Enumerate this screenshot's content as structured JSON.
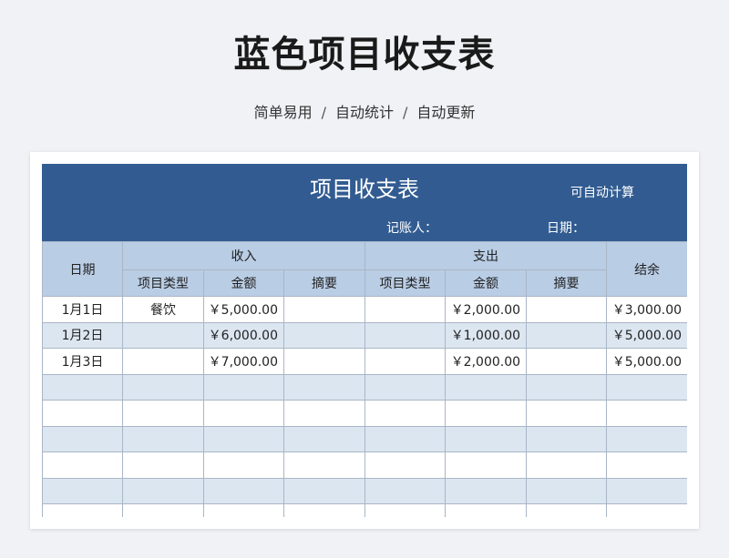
{
  "page": {
    "title": "蓝色项目收支表",
    "subtitle": [
      "简单易用",
      "自动统计",
      "自动更新"
    ],
    "subtitle_separator": "/"
  },
  "sheet": {
    "title": "项目收支表",
    "auto_calc": "可自动计算",
    "recorder_label": "记账人：",
    "date_label": "日期："
  },
  "table": {
    "headers": {
      "date": "日期",
      "income": "收入",
      "expense": "支出",
      "balance": "结余",
      "type": "项目类型",
      "amount": "金额",
      "memo": "摘要"
    },
    "rows": [
      {
        "date": "1月1日",
        "in_type": "餐饮",
        "in_amount": "￥5,000.00",
        "in_memo": "",
        "out_type": "",
        "out_amount": "￥2,000.00",
        "out_memo": "",
        "balance": "￥3,000.00"
      },
      {
        "date": "1月2日",
        "in_type": "",
        "in_amount": "￥6,000.00",
        "in_memo": "",
        "out_type": "",
        "out_amount": "￥1,000.00",
        "out_memo": "",
        "balance": "￥5,000.00"
      },
      {
        "date": "1月3日",
        "in_type": "",
        "in_amount": "￥7,000.00",
        "in_memo": "",
        "out_type": "",
        "out_amount": "￥2,000.00",
        "out_memo": "",
        "balance": "￥5,000.00"
      },
      {
        "date": "",
        "in_type": "",
        "in_amount": "",
        "in_memo": "",
        "out_type": "",
        "out_amount": "",
        "out_memo": "",
        "balance": ""
      },
      {
        "date": "",
        "in_type": "",
        "in_amount": "",
        "in_memo": "",
        "out_type": "",
        "out_amount": "",
        "out_memo": "",
        "balance": ""
      },
      {
        "date": "",
        "in_type": "",
        "in_amount": "",
        "in_memo": "",
        "out_type": "",
        "out_amount": "",
        "out_memo": "",
        "balance": ""
      },
      {
        "date": "",
        "in_type": "",
        "in_amount": "",
        "in_memo": "",
        "out_type": "",
        "out_amount": "",
        "out_memo": "",
        "balance": ""
      },
      {
        "date": "",
        "in_type": "",
        "in_amount": "",
        "in_memo": "",
        "out_type": "",
        "out_amount": "",
        "out_memo": "",
        "balance": ""
      },
      {
        "date": "",
        "in_type": "",
        "in_amount": "",
        "in_memo": "",
        "out_type": "",
        "out_amount": "",
        "out_memo": "",
        "balance": ""
      }
    ]
  },
  "colors": {
    "banner": "#325c91",
    "header": "#b9cde5",
    "stripe": "#dce6f1",
    "border": "#a9b6c6"
  }
}
